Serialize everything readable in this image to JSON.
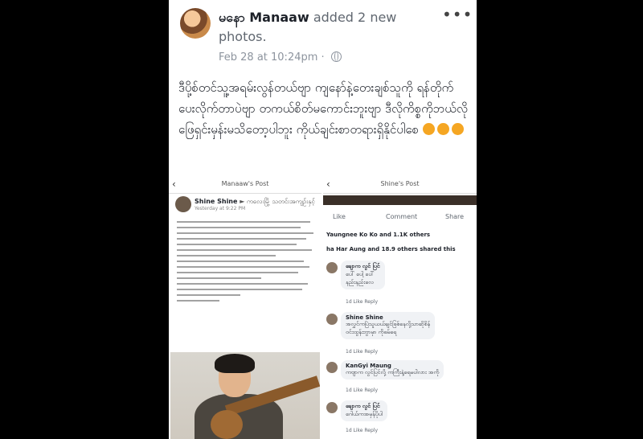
{
  "post": {
    "author": "မနော Manaaw",
    "action": "added 2 new photos.",
    "timestamp": "Feb 28 at 10:24pm",
    "body": "ဒီပို့စ်တင်သူ့အရမ်းလွန်တယ်ဗျာ ကျနော်နဲ့တေးချစ်သူကို ရန်တိုက်ပေးလိုက်တာပဲဗျာ တကယ်စိတ်မကောင်းဘူးဗျာ ဒီလိုကိစ္စကိုဘယ်လိုဖြေရှင်းမှန်းမသိတော့ပါဘူး ကိုယ်ချင်းစာတရားရှိနိုင်ပါစေ"
  },
  "left_screenshot": {
    "title": "Manaaw's Post",
    "poster": "Shine Shine",
    "poster_suffix": "► ကလေးမြို့ သတင်းအကျဉ်းနှင့်",
    "time": "Yesterday at 9:22 PM"
  },
  "right_screenshot": {
    "title": "Shine's Post",
    "like": "Like",
    "comment": "Comment",
    "share": "Share",
    "reactions": "Yaungnee Ko Ko and 1.1K others",
    "shares": "ha Har Aung and 18.9 others shared this",
    "comments": [
      {
        "name": "ချောက လွင် ပြင်",
        "text": "ပေါ် ပေါ့ ပေါ်\nနည်းနည်းလေ",
        "meta": "1d   Like   Reply"
      },
      {
        "name": "Shine Shine",
        "text": "အလွှင်ကပြဲသူယယ်ချင်ဖြစ်နေလို့သာဆိုစိန်\nဝင်းထွန်းဘွာမှာ ကိုဖမ်ရေ",
        "meta": "1d   Like   Reply"
      },
      {
        "name": "KanGyi Maung",
        "text": "ကဗျာက လွင်ပြင်လို့ ကကြီးနဲ့ရေမပါလား အကို",
        "meta": "1d   Like   Reply"
      },
      {
        "name": "ချောက လွင် ပြင်",
        "text": "ဂေါယ်ကအမှန်ပိုပါ",
        "meta": "1d   Like   Reply"
      }
    ]
  },
  "colors": {
    "background": "#000000",
    "card": "#ffffff",
    "meta": "#8d949e"
  }
}
